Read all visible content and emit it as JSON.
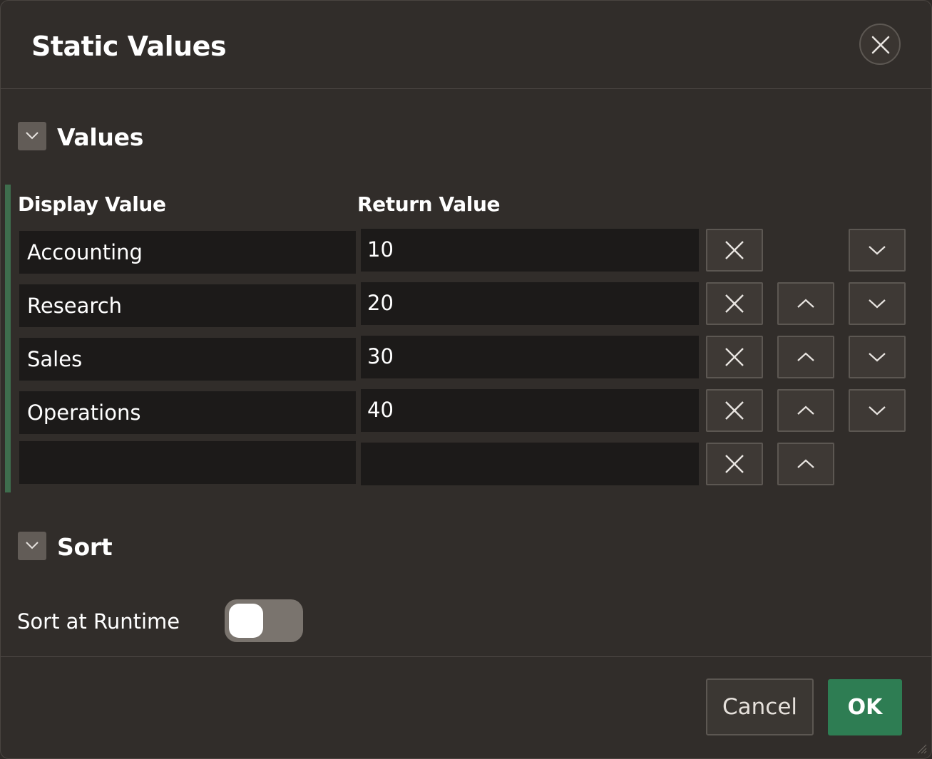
{
  "dialog": {
    "title": "Static Values",
    "close_icon": "close-icon"
  },
  "values_section": {
    "title": "Values",
    "toggle_icon": "chevron-down-icon",
    "columns": {
      "display": "Display Value",
      "return": "Return Value"
    },
    "rows": [
      {
        "display": "Accounting",
        "return": "10"
      },
      {
        "display": "Research",
        "return": "20"
      },
      {
        "display": "Sales",
        "return": "30"
      },
      {
        "display": "Operations",
        "return": "40"
      },
      {
        "display": "",
        "return": ""
      }
    ]
  },
  "sort_section": {
    "title": "Sort",
    "toggle_icon": "chevron-down-icon",
    "sort_at_runtime_label": "Sort at Runtime",
    "sort_at_runtime_on": false
  },
  "footer": {
    "cancel_label": "Cancel",
    "ok_label": "OK"
  },
  "colors": {
    "background": "#312d2a",
    "input_background": "#1c1a19",
    "accent_green": "#2e7d53",
    "grid_accent": "#3e6d4d"
  }
}
